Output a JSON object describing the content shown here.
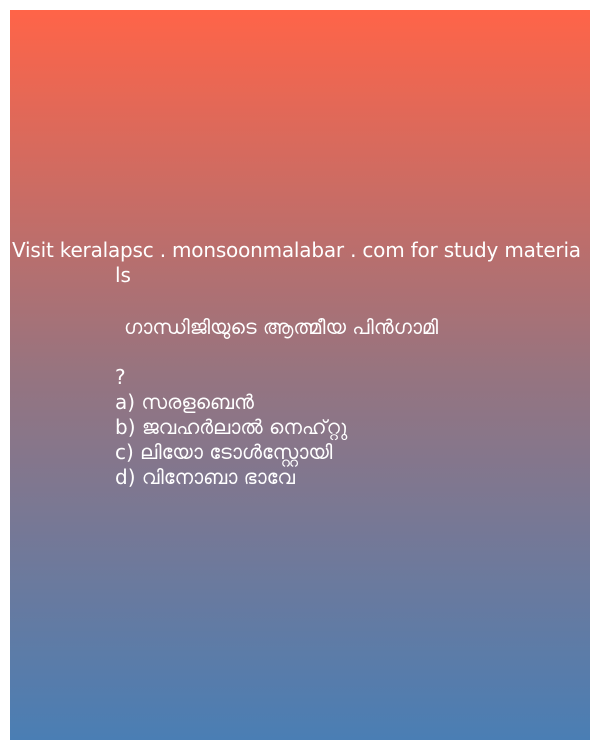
{
  "banner": {
    "visit_text": "Visit keralapsc . monsoonmalabar . com for study materia",
    "visit_text_wrap": "ls"
  },
  "question": {
    "text": "ഗാന്ധിജിയുടെ ആത്മീയ പിൻഗാമി",
    "mark": "?",
    "options": [
      "a) സരളബെൻ",
      "b) ജവഹർലാൽ നെഹ്റ്റു",
      "c) ലിയോ ടോൾസ്റ്റോയി",
      "d) വിനോബാ ഭാവേ"
    ]
  },
  "colors": {
    "gradient_top": "#ff6448",
    "gradient_mid": "#967480",
    "gradient_bottom": "#4a7eb4",
    "text": "#ffffff"
  }
}
